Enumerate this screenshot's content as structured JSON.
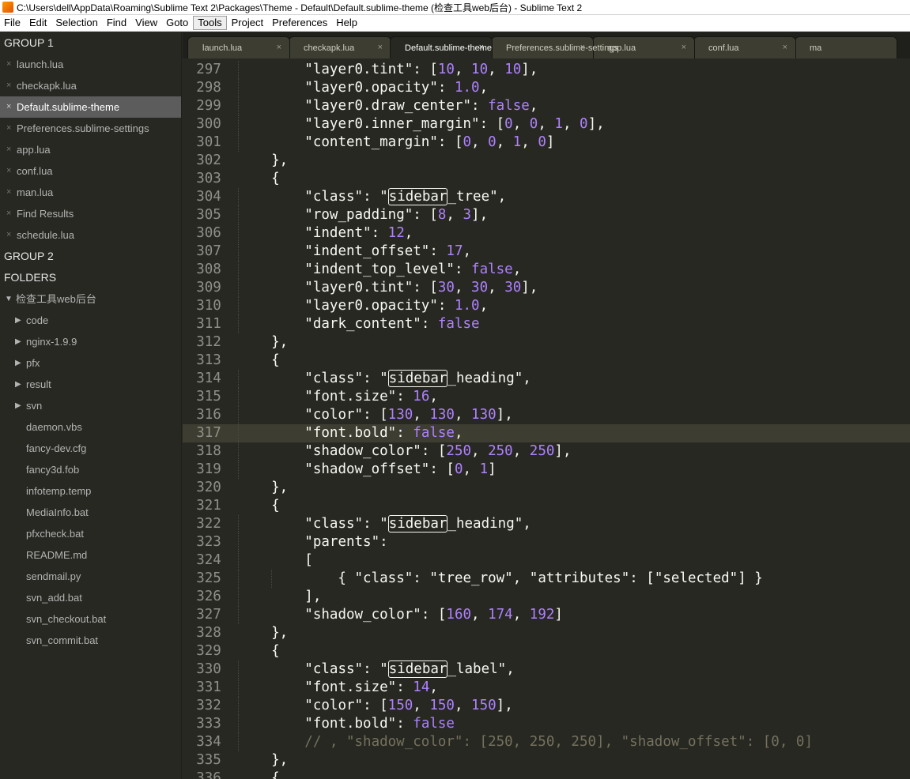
{
  "window": {
    "title": "C:\\Users\\dell\\AppData\\Roaming\\Sublime Text 2\\Packages\\Theme - Default\\Default.sublime-theme (检查工具web后台) - Sublime Text 2"
  },
  "menu": [
    "File",
    "Edit",
    "Selection",
    "Find",
    "View",
    "Goto",
    "Tools",
    "Project",
    "Preferences",
    "Help"
  ],
  "menu_active": "Tools",
  "sidebar": {
    "group1_label": "GROUP 1",
    "open_files": [
      {
        "name": "launch.lua",
        "selected": false
      },
      {
        "name": "checkapk.lua",
        "selected": false
      },
      {
        "name": "Default.sublime-theme",
        "selected": true
      },
      {
        "name": "Preferences.sublime-settings",
        "selected": false
      },
      {
        "name": "app.lua",
        "selected": false
      },
      {
        "name": "conf.lua",
        "selected": false
      },
      {
        "name": "man.lua",
        "selected": false
      },
      {
        "name": "Find Results",
        "selected": false
      },
      {
        "name": "schedule.lua",
        "selected": false
      }
    ],
    "group2_label": "GROUP 2",
    "folders_label": "FOLDERS",
    "root_folder": "检查工具web后台",
    "subfolders": [
      "code",
      "nginx-1.9.9",
      "pfx",
      "result",
      "svn"
    ],
    "files": [
      "daemon.vbs",
      "fancy-dev.cfg",
      "fancy3d.fob",
      "infotemp.temp",
      "MediaInfo.bat",
      "pfxcheck.bat",
      "README.md",
      "sendmail.py",
      "svn_add.bat",
      "svn_checkout.bat",
      "svn_commit.bat"
    ]
  },
  "tabs": [
    {
      "label": "launch.lua",
      "active": false
    },
    {
      "label": "checkapk.lua",
      "active": false
    },
    {
      "label": "Default.sublime-theme",
      "active": true
    },
    {
      "label": "Preferences.sublime-settings",
      "active": false
    },
    {
      "label": "app.lua",
      "active": false
    },
    {
      "label": "conf.lua",
      "active": false
    },
    {
      "label": "ma",
      "active": false
    }
  ],
  "tab_close_glyph": "×",
  "editor": {
    "current_line": 317,
    "lines": [
      {
        "num": "297",
        "code": "        \"layer0.tint\": [10, 10, 10],"
      },
      {
        "num": "298",
        "code": "        \"layer0.opacity\": 1.0,"
      },
      {
        "num": "299",
        "code": "        \"layer0.draw_center\": false,"
      },
      {
        "num": "300",
        "code": "        \"layer0.inner_margin\": [0, 0, 1, 0],"
      },
      {
        "num": "301",
        "code": "        \"content_margin\": [0, 0, 1, 0]"
      },
      {
        "num": "302",
        "code": "    },"
      },
      {
        "num": "303",
        "code": "    {"
      },
      {
        "num": "304",
        "code": "        \"class\": \"sidebar_tree\","
      },
      {
        "num": "305",
        "code": "        \"row_padding\": [8, 3],"
      },
      {
        "num": "306",
        "code": "        \"indent\": 12,"
      },
      {
        "num": "307",
        "code": "        \"indent_offset\": 17,"
      },
      {
        "num": "308",
        "code": "        \"indent_top_level\": false,"
      },
      {
        "num": "309",
        "code": "        \"layer0.tint\": [30, 30, 30],"
      },
      {
        "num": "310",
        "code": "        \"layer0.opacity\": 1.0,"
      },
      {
        "num": "311",
        "code": "        \"dark_content\": false"
      },
      {
        "num": "312",
        "code": "    },"
      },
      {
        "num": "313",
        "code": "    {"
      },
      {
        "num": "314",
        "code": "        \"class\": \"sidebar_heading\","
      },
      {
        "num": "315",
        "code": "        \"font.size\": 16,"
      },
      {
        "num": "316",
        "code": "        \"color\": [130, 130, 130],"
      },
      {
        "num": "317",
        "code": "        \"font.bold\": false,"
      },
      {
        "num": "318",
        "code": "        \"shadow_color\": [250, 250, 250],"
      },
      {
        "num": "319",
        "code": "        \"shadow_offset\": [0, 1]"
      },
      {
        "num": "320",
        "code": "    },"
      },
      {
        "num": "321",
        "code": "    {"
      },
      {
        "num": "322",
        "code": "        \"class\": \"sidebar_heading\","
      },
      {
        "num": "323",
        "code": "        \"parents\":"
      },
      {
        "num": "324",
        "code": "        ["
      },
      {
        "num": "325",
        "code": "            { \"class\": \"tree_row\", \"attributes\": [\"selected\"] }"
      },
      {
        "num": "326",
        "code": "        ],"
      },
      {
        "num": "327",
        "code": "        \"shadow_color\": [160, 174, 192]"
      },
      {
        "num": "328",
        "code": "    },"
      },
      {
        "num": "329",
        "code": "    {"
      },
      {
        "num": "330",
        "code": "        \"class\": \"sidebar_label\","
      },
      {
        "num": "331",
        "code": "        \"font.size\": 14,"
      },
      {
        "num": "332",
        "code": "        \"color\": [150, 150, 150],"
      },
      {
        "num": "333",
        "code": "        \"font.bold\": false"
      },
      {
        "num": "334",
        "code": "        // , \"shadow_color\": [250, 250, 250], \"shadow_offset\": [0, 0]"
      },
      {
        "num": "335",
        "code": "    },"
      },
      {
        "num": "336",
        "code": "    {"
      }
    ],
    "highlight_word": "sidebar"
  },
  "colors": {
    "background": "#272822",
    "foreground": "#f8f8f2",
    "number": "#ae81ff",
    "comment": "#75715e",
    "line_highlight": "#3e3d32",
    "gutter_text": "#90908a"
  }
}
